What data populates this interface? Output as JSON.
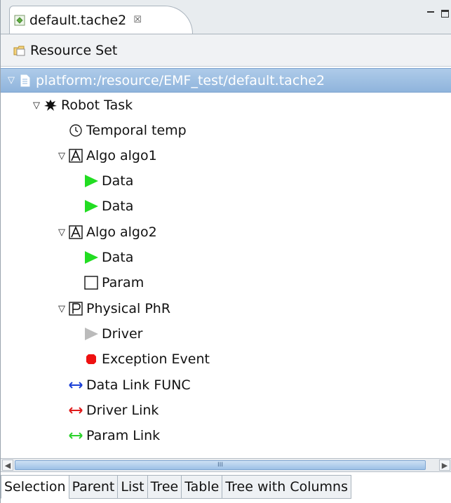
{
  "editor_tab": {
    "title": "default.tache2",
    "close_glyph": "☒"
  },
  "resource_set": {
    "label": "Resource Set"
  },
  "tree": {
    "items": [
      {
        "label": "platform:/resource/EMF_test/default.tache2",
        "icon": "file-icon",
        "selected": true,
        "expanded": true
      },
      {
        "label": "Robot Task",
        "icon": "robot-task-icon",
        "expanded": true
      },
      {
        "label": "Temporal temp",
        "icon": "clock-icon"
      },
      {
        "label": "Algo algo1",
        "icon": "algo-icon",
        "expanded": true
      },
      {
        "label": "Data",
        "icon": "data-arrow-icon"
      },
      {
        "label": "Data",
        "icon": "data-arrow-icon"
      },
      {
        "label": "Algo algo2",
        "icon": "algo-icon",
        "expanded": true
      },
      {
        "label": "Data",
        "icon": "data-arrow-icon"
      },
      {
        "label": "Param",
        "icon": "param-square-icon"
      },
      {
        "label": "Physical PhR",
        "icon": "physical-icon",
        "expanded": true
      },
      {
        "label": "Driver",
        "icon": "driver-arrow-icon"
      },
      {
        "label": "Exception Event",
        "icon": "exception-dot-icon"
      },
      {
        "label": "Data Link FUNC",
        "icon": "data-link-icon"
      },
      {
        "label": "Driver Link",
        "icon": "driver-link-icon"
      },
      {
        "label": "Param Link",
        "icon": "param-link-icon"
      }
    ]
  },
  "scrollbar": {
    "thumb_grip": "III"
  },
  "bottom_tabs": [
    {
      "label": "Selection",
      "active": true
    },
    {
      "label": "Parent"
    },
    {
      "label": "List"
    },
    {
      "label": "Tree"
    },
    {
      "label": "Table"
    },
    {
      "label": "Tree with Columns"
    }
  ],
  "colors": {
    "selection": "#8fb4dc",
    "data_arrow": "#22dd22",
    "driver_arrow": "#bbbbbb",
    "exception": "#ee1111",
    "data_link": "#1a3fd6",
    "driver_link": "#e01b1b",
    "param_link": "#2bd22b"
  }
}
